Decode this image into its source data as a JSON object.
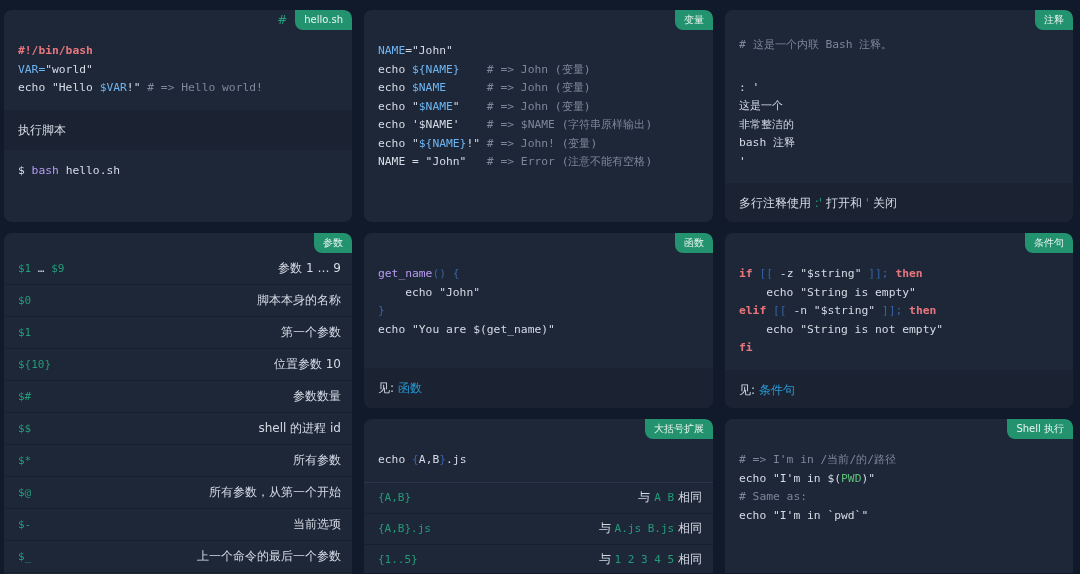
{
  "columns": [
    {
      "cards": [
        {
          "tag": "hello.sh",
          "anchor": "#",
          "sections": [
            {
              "kind": "code",
              "lines": [
                [
                  {
                    "text": "#!/bin/bash",
                    "kind": "kw"
                  }
                ],
                [
                  {
                    "text": "VAR=",
                    "kind": "var"
                  },
                  {
                    "text": "\"world\"",
                    "kind": "plain"
                  }
                ],
                [
                  {
                    "text": "echo \"Hello ",
                    "kind": "plain"
                  },
                  {
                    "text": "$VAR",
                    "kind": "var"
                  },
                  {
                    "text": "!\" ",
                    "kind": "plain"
                  },
                  {
                    "text": "# => Hello world!",
                    "kind": "cmt"
                  }
                ]
              ]
            },
            {
              "kind": "note",
              "parts": [
                {
                  "text": "执行脚本",
                  "kind": "plain"
                }
              ]
            },
            {
              "kind": "code",
              "lines": [
                [
                  {
                    "text": "$ ",
                    "kind": "plain"
                  },
                  {
                    "text": "bash",
                    "kind": "fn"
                  },
                  {
                    "text": " hello.sh",
                    "kind": "plain"
                  }
                ]
              ]
            }
          ]
        },
        {
          "tag": "参数",
          "sections": [
            {
              "kind": "table",
              "rows": [
                {
                  "code": [
                    {
                      "text": "$1",
                      "kind": "teal"
                    },
                    {
                      "text": " … ",
                      "kind": "plain"
                    },
                    {
                      "text": "$9",
                      "kind": "teal"
                    }
                  ],
                  "desc": [
                    {
                      "text": "参数 1 … 9",
                      "kind": "plain"
                    }
                  ]
                },
                {
                  "code": [
                    {
                      "text": "$0",
                      "kind": "teal"
                    }
                  ],
                  "desc": [
                    {
                      "text": "脚本本身的名称",
                      "kind": "plain"
                    }
                  ]
                },
                {
                  "code": [
                    {
                      "text": "$1",
                      "kind": "teal"
                    }
                  ],
                  "desc": [
                    {
                      "text": "第一个参数",
                      "kind": "plain"
                    }
                  ]
                },
                {
                  "code": [
                    {
                      "text": "${10}",
                      "kind": "teal"
                    }
                  ],
                  "desc": [
                    {
                      "text": "位置参数 10",
                      "kind": "plain"
                    }
                  ]
                },
                {
                  "code": [
                    {
                      "text": "$#",
                      "kind": "teal"
                    }
                  ],
                  "desc": [
                    {
                      "text": "参数数量",
                      "kind": "plain"
                    }
                  ]
                },
                {
                  "code": [
                    {
                      "text": "$$",
                      "kind": "teal"
                    }
                  ],
                  "desc": [
                    {
                      "text": "shell 的进程 id",
                      "kind": "plain"
                    }
                  ]
                },
                {
                  "code": [
                    {
                      "text": "$*",
                      "kind": "teal"
                    }
                  ],
                  "desc": [
                    {
                      "text": "所有参数",
                      "kind": "plain"
                    }
                  ]
                },
                {
                  "code": [
                    {
                      "text": "$@",
                      "kind": "teal"
                    }
                  ],
                  "desc": [
                    {
                      "text": "所有参数，从第一个开始",
                      "kind": "plain"
                    }
                  ]
                },
                {
                  "code": [
                    {
                      "text": "$-",
                      "kind": "teal"
                    }
                  ],
                  "desc": [
                    {
                      "text": "当前选项",
                      "kind": "plain"
                    }
                  ]
                },
                {
                  "code": [
                    {
                      "text": "$_",
                      "kind": "teal"
                    }
                  ],
                  "desc": [
                    {
                      "text": "上一个命令的最后一个参数",
                      "kind": "plain"
                    }
                  ]
                }
              ]
            }
          ]
        }
      ]
    },
    {
      "cards": [
        {
          "tag": "变量",
          "sections": [
            {
              "kind": "code",
              "lines": [
                [
                  {
                    "text": "NAME",
                    "kind": "var"
                  },
                  {
                    "text": "=\"John\"",
                    "kind": "plain"
                  }
                ],
                [
                  {
                    "text": "echo ",
                    "kind": "plain"
                  },
                  {
                    "text": "${NAME}",
                    "kind": "var"
                  },
                  {
                    "text": "    # => John (变量)",
                    "kind": "cmt"
                  }
                ],
                [
                  {
                    "text": "echo ",
                    "kind": "plain"
                  },
                  {
                    "text": "$NAME",
                    "kind": "var"
                  },
                  {
                    "text": "      # => John (变量)",
                    "kind": "cmt"
                  }
                ],
                [
                  {
                    "text": "echo \"",
                    "kind": "plain"
                  },
                  {
                    "text": "$NAME",
                    "kind": "var"
                  },
                  {
                    "text": "\"",
                    "kind": "plain"
                  },
                  {
                    "text": "    # => John (变量)",
                    "kind": "cmt"
                  }
                ],
                [
                  {
                    "text": "echo '$NAME'",
                    "kind": "plain"
                  },
                  {
                    "text": "    # => $NAME (字符串原样输出)",
                    "kind": "cmt"
                  }
                ],
                [
                  {
                    "text": "echo \"",
                    "kind": "plain"
                  },
                  {
                    "text": "${NAME}",
                    "kind": "var"
                  },
                  {
                    "text": "!\"",
                    "kind": "plain"
                  },
                  {
                    "text": " # => John! (变量)",
                    "kind": "cmt"
                  }
                ],
                [
                  {
                    "text": "NAME = \"John\"",
                    "kind": "plain"
                  },
                  {
                    "text": "   # => Error (注意不能有空格)",
                    "kind": "cmt"
                  }
                ]
              ]
            }
          ]
        },
        {
          "tag": "函数",
          "sections": [
            {
              "kind": "code",
              "lines": [
                [
                  {
                    "text": "get_name",
                    "kind": "fn"
                  },
                  {
                    "text": "() {",
                    "kind": "punct"
                  }
                ],
                [
                  {
                    "text": "    echo \"John\"",
                    "kind": "plain"
                  }
                ],
                [
                  {
                    "text": "}",
                    "kind": "punct"
                  }
                ],
                [
                  {
                    "text": "echo \"You are $(get_name)\"",
                    "kind": "plain"
                  }
                ]
              ]
            },
            {
              "kind": "note",
              "parts": [
                {
                  "text": "见: ",
                  "kind": "plain"
                },
                {
                  "text": "函数",
                  "kind": "link"
                }
              ]
            }
          ]
        },
        {
          "tag": "大括号扩展",
          "sections": [
            {
              "kind": "code",
              "lines": [
                [
                  {
                    "text": "echo ",
                    "kind": "plain"
                  },
                  {
                    "text": "{",
                    "kind": "punct"
                  },
                  {
                    "text": "A,B",
                    "kind": "plain"
                  },
                  {
                    "text": "}",
                    "kind": "punct"
                  },
                  {
                    "text": ".js",
                    "kind": "plain"
                  }
                ]
              ]
            },
            {
              "kind": "table",
              "rows": [
                {
                  "code": [
                    {
                      "text": "{A,B}",
                      "kind": "teal"
                    }
                  ],
                  "desc": [
                    {
                      "text": "与 ",
                      "kind": "plain"
                    },
                    {
                      "text": "A B",
                      "kind": "teal"
                    },
                    {
                      "text": " 相同",
                      "kind": "plain"
                    }
                  ]
                },
                {
                  "code": [
                    {
                      "text": "{A,B}.js",
                      "kind": "teal"
                    }
                  ],
                  "desc": [
                    {
                      "text": "与 ",
                      "kind": "plain"
                    },
                    {
                      "text": "A.js B.js",
                      "kind": "teal"
                    },
                    {
                      "text": " 相同",
                      "kind": "plain"
                    }
                  ]
                },
                {
                  "code": [
                    {
                      "text": "{1..5}",
                      "kind": "teal"
                    }
                  ],
                  "desc": [
                    {
                      "text": "与 ",
                      "kind": "plain"
                    },
                    {
                      "text": "1 2 3 4 5",
                      "kind": "teal"
                    },
                    {
                      "text": " 相同",
                      "kind": "plain"
                    }
                  ]
                }
              ]
            }
          ]
        }
      ]
    },
    {
      "cards": [
        {
          "tag": "注释",
          "sections": [
            {
              "kind": "code",
              "lines": [
                [
                  {
                    "text": "# 这是一个内联 Bash 注释。",
                    "kind": "cmt"
                  }
                ]
              ]
            },
            {
              "kind": "code",
              "lines": [
                [
                  {
                    "text": ": '",
                    "kind": "plain"
                  }
                ],
                [
                  {
                    "text": "这是一个",
                    "kind": "plain"
                  }
                ],
                [
                  {
                    "text": "非常整洁的",
                    "kind": "plain"
                  }
                ],
                [
                  {
                    "text": "bash 注释",
                    "kind": "plain"
                  }
                ],
                [
                  {
                    "text": "'",
                    "kind": "plain"
                  }
                ]
              ]
            },
            {
              "kind": "note",
              "parts": [
                {
                  "text": "多行注释使用 ",
                  "kind": "plain"
                },
                {
                  "text": ":'",
                  "kind": "teal"
                },
                {
                  "text": " 打开和 ",
                  "kind": "plain"
                },
                {
                  "text": "'",
                  "kind": "teal"
                },
                {
                  "text": " 关闭",
                  "kind": "plain"
                }
              ]
            }
          ]
        },
        {
          "tag": "条件句",
          "sections": [
            {
              "kind": "code",
              "lines": [
                [
                  {
                    "text": "if",
                    "kind": "kw"
                  },
                  {
                    "text": " [[ ",
                    "kind": "punct"
                  },
                  {
                    "text": "-z \"$string\"",
                    "kind": "plain"
                  },
                  {
                    "text": " ]]; ",
                    "kind": "punct"
                  },
                  {
                    "text": "then",
                    "kind": "kw"
                  }
                ],
                [
                  {
                    "text": "    echo \"String is empty\"",
                    "kind": "plain"
                  }
                ],
                [
                  {
                    "text": "elif",
                    "kind": "kw"
                  },
                  {
                    "text": " [[ ",
                    "kind": "punct"
                  },
                  {
                    "text": "-n \"$string\"",
                    "kind": "plain"
                  },
                  {
                    "text": " ]]; ",
                    "kind": "punct"
                  },
                  {
                    "text": "then",
                    "kind": "kw"
                  }
                ],
                [
                  {
                    "text": "    echo \"String is not empty\"",
                    "kind": "plain"
                  }
                ],
                [
                  {
                    "text": "fi",
                    "kind": "kw"
                  }
                ]
              ]
            },
            {
              "kind": "note",
              "parts": [
                {
                  "text": "见: ",
                  "kind": "plain"
                },
                {
                  "text": "条件句",
                  "kind": "link"
                }
              ]
            }
          ]
        },
        {
          "tag": "Shell 执行",
          "sections": [
            {
              "kind": "code",
              "lines": [
                [
                  {
                    "text": "# => I'm in /当前/的/路径",
                    "kind": "cmt"
                  }
                ],
                [
                  {
                    "text": "echo \"I'm in $(",
                    "kind": "plain"
                  },
                  {
                    "text": "PWD",
                    "kind": "green"
                  },
                  {
                    "text": ")\"",
                    "kind": "plain"
                  }
                ],
                [
                  {
                    "text": "# Same as:",
                    "kind": "cmt"
                  }
                ],
                [
                  {
                    "text": "echo \"I'm in `pwd`\"",
                    "kind": "plain"
                  }
                ]
              ]
            }
          ]
        }
      ]
    }
  ]
}
